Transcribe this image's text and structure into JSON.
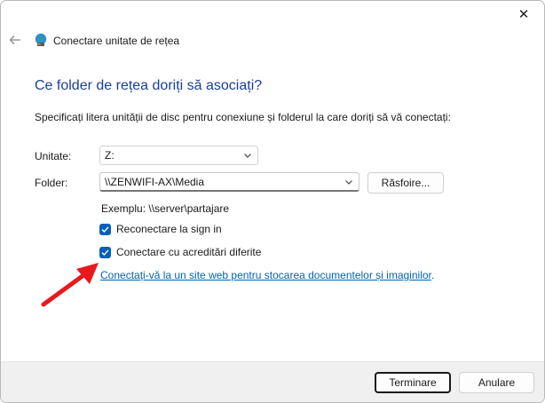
{
  "window": {
    "title": "Conectare unitate de rețea",
    "close_glyph": "✕"
  },
  "wizard": {
    "heading": "Ce folder de rețea doriți să asociați?",
    "description": "Specificați litera unității de disc pentru conexiune și folderul la care doriți să vă conectați:",
    "drive_label": "Unitate:",
    "drive_value": "Z:",
    "folder_label": "Folder:",
    "folder_value": "\\\\ZENWIFI-AX\\Media",
    "browse_label": "Răsfoire...",
    "example": "Exemplu: \\\\server\\partajare",
    "reconnect_label": "Reconectare la sign in",
    "reconnect_checked": true,
    "credentials_label": "Conectare cu acreditări diferite",
    "credentials_checked": true,
    "link_text": "Conectați-vă la un site web pentru stocarea documentelor și imaginilor",
    "link_suffix": "."
  },
  "footer": {
    "finish_label": "Terminare",
    "cancel_label": "Anulare"
  },
  "colors": {
    "heading": "#1c3f94",
    "checkbox": "#005fb8",
    "link": "#0063b1",
    "annotation_arrow": "#e8191c"
  },
  "icons": {
    "back": "back-arrow-icon",
    "app": "network-drive-icon",
    "chevron": "chevron-down-icon",
    "check": "checkmark-icon",
    "annotation": "red-arrow-icon"
  }
}
